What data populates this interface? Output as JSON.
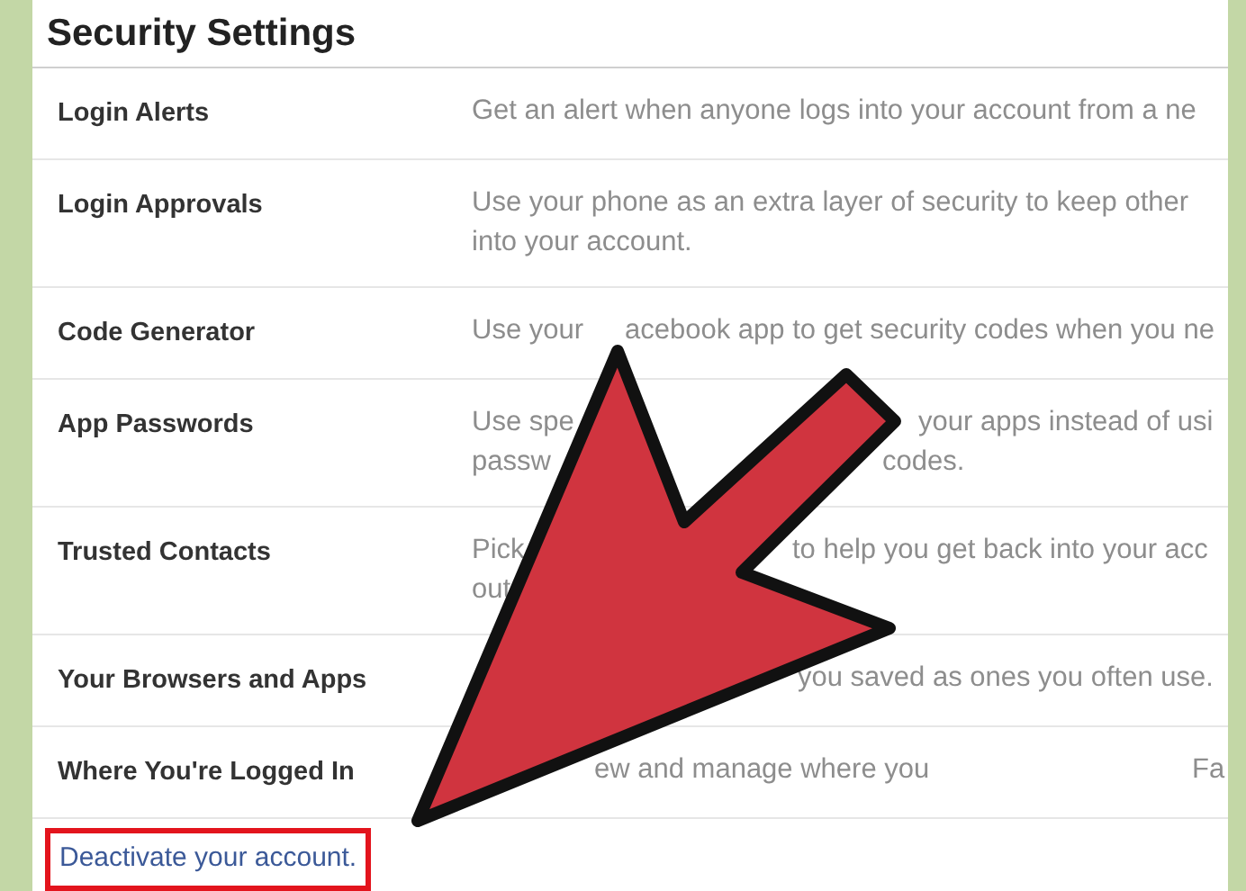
{
  "title": "Security Settings",
  "rows": [
    {
      "label": "Login Alerts",
      "lines": [
        [
          "Get an alert when anyone logs into your account from a ne"
        ]
      ]
    },
    {
      "label": "Login Approvals",
      "lines": [
        [
          "Use your phone as an extra layer of security to keep other"
        ],
        [
          "into your account."
        ]
      ]
    },
    {
      "label": "Code Generator",
      "lines": [
        [
          "Use your",
          "acebook app to get security codes when you ne"
        ]
      ]
    },
    {
      "label": "App Passwords",
      "lines": [
        [
          "Use spe",
          "your apps instead of usi"
        ],
        [
          "passw",
          "codes."
        ]
      ]
    },
    {
      "label": "Trusted Contacts",
      "lines": [
        [
          "Pick",
          "to help you get back into your acc"
        ],
        [
          "out"
        ]
      ]
    },
    {
      "label": "Your Browsers and Apps",
      "lines": [
        [
          "you saved as ones you often use."
        ]
      ]
    },
    {
      "label": "Where You're Logged In",
      "lines": [
        [
          "ew and manage where you",
          "Fa"
        ]
      ]
    }
  ],
  "deactivate_link": "Deactivate your account."
}
